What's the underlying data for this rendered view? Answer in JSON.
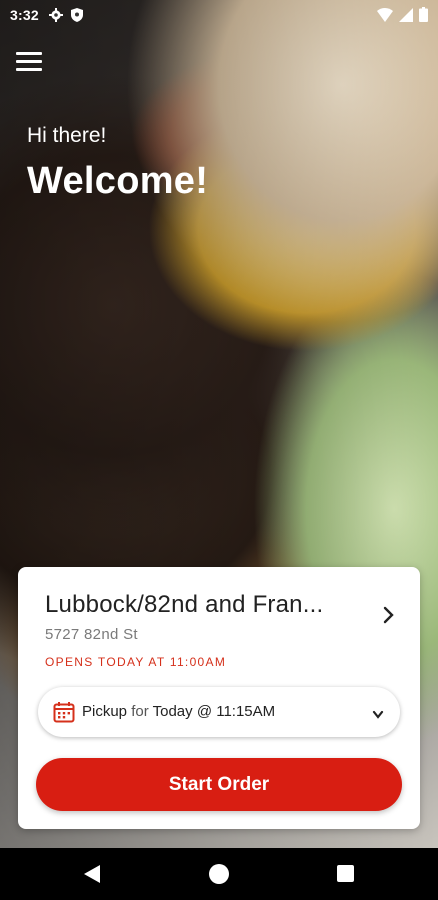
{
  "status_bar": {
    "time": "3:32",
    "icons": [
      "gear-icon",
      "shield-icon",
      "wifi-icon",
      "signal-icon",
      "battery-icon"
    ]
  },
  "header": {
    "menu_icon": "hamburger-menu-icon",
    "greeting": "Hi there!",
    "welcome": "Welcome!"
  },
  "location_card": {
    "name": "Lubbock/82nd and Fran...",
    "address": "5727 82nd St",
    "hours": "OPENS TODAY AT 11:00AM",
    "hours_color": "#d5301b"
  },
  "pickup": {
    "icon": "calendar-icon",
    "mode": "Pickup",
    "for_label": "for",
    "when": "Today @ 11:15AM"
  },
  "start_order": {
    "label": "Start Order",
    "color": "#d81e12"
  },
  "nav_bar": {
    "icons": [
      "back-icon",
      "home-icon",
      "recents-icon"
    ]
  }
}
